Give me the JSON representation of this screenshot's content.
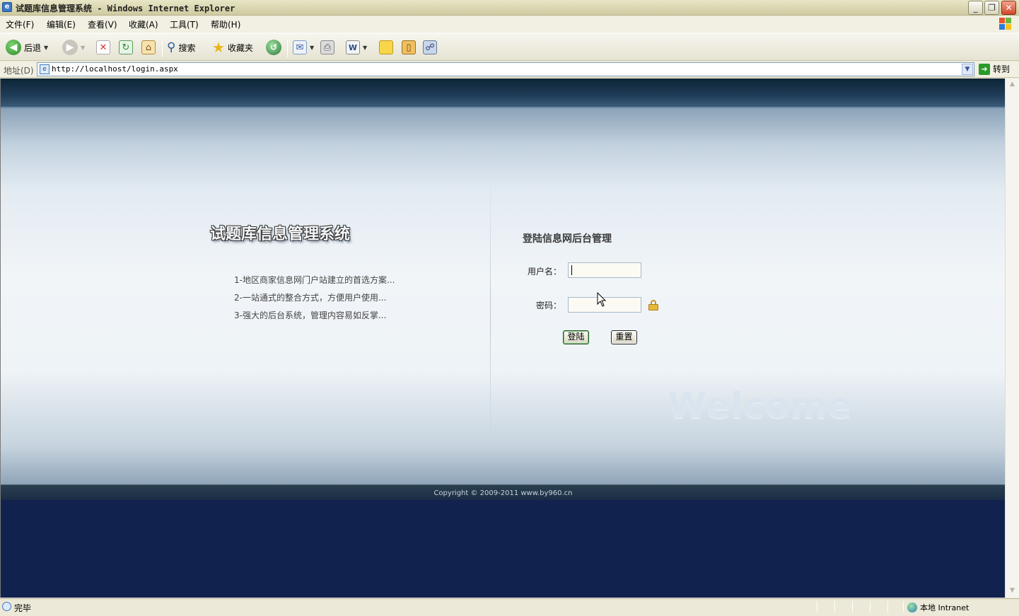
{
  "window": {
    "title": "试题库信息管理系统 - Windows Internet Explorer",
    "minimize": "_",
    "restore": "❐",
    "close": "✕"
  },
  "menu": [
    "文件(F)",
    "编辑(E)",
    "查看(V)",
    "收藏(A)",
    "工具(T)",
    "帮助(H)"
  ],
  "toolbar": {
    "back_label": "后退",
    "search_label": "搜索",
    "favorites_label": "收藏夹"
  },
  "address": {
    "label": "地址(D)",
    "url": "http://localhost/login.aspx",
    "go_label": "转到"
  },
  "page": {
    "system_title": "试题库信息管理系统",
    "features": [
      "1-地区商家信息网门户站建立的首选方案...",
      "2-一站通式的整合方式，方便用户使用...",
      "3-强大的后台系统，管理内容易如反掌..."
    ],
    "login_title": "登陆信息网后台管理",
    "username_label": "用户名：",
    "username_value": "",
    "password_label": "密码：",
    "password_value": "",
    "login_button": "登陆",
    "reset_button": "重置",
    "welcome": "Welcome",
    "copyright": "Copyright © 2009-2011 www.by960.cn"
  },
  "status": {
    "text": "完毕",
    "zone": "本地 Intranet"
  },
  "colors": {
    "header_band": "#1f3d58",
    "footer_band": "#12224f",
    "login_button_border": "#1f5a1f"
  }
}
